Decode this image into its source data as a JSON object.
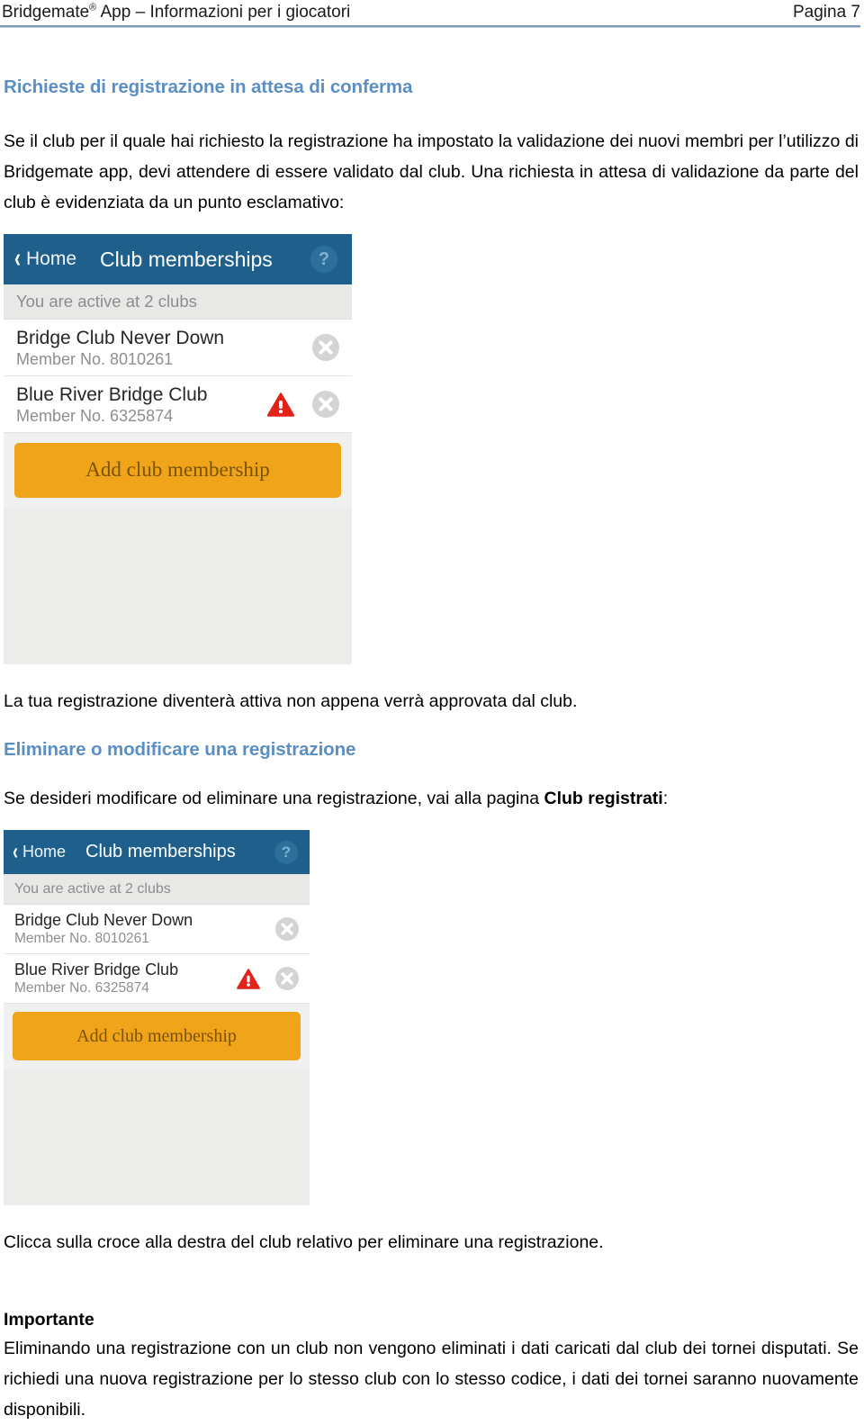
{
  "header": {
    "left_text": "Bridgemate",
    "left_sup": "®",
    "left_rest": " App – Informazioni per i giocatori",
    "page_label": "Pagina 7"
  },
  "sections": {
    "heading_1": "Richieste di registrazione in attesa di conferma",
    "paragraph_1": "Se il club per il quale hai richiesto la registrazione ha impostato la validazione dei nuovi membri per l’utilizzo di Bridgemate app, devi attendere di essere validato dal club. Una richiesta in attesa di validazione da parte del club è evidenziata da un punto esclamativo:",
    "paragraph_2": "La tua registrazione diventerà attiva non appena verrà approvata dal club.",
    "heading_2": "Eliminare o modificare una registrazione",
    "paragraph_3_before": "Se desideri modificare od eliminare una registrazione, vai alla pagina ",
    "paragraph_3_bold": "Club registrati",
    "paragraph_3_after": ":",
    "paragraph_4": "Clicca sulla croce alla destra del club relativo per eliminare una registrazione.",
    "heading_3": "Importante",
    "paragraph_5": "Eliminando una registrazione con un club non vengono eliminati i dati caricati dal club dei tornei disputati. Se richiedi una nuova registrazione per lo stesso club con lo stesso codice, i dati dei tornei saranno nuovamente disponibili."
  },
  "app_screenshot": {
    "back_label": "Home",
    "title": "Club memberships",
    "help_glyph": "?",
    "back_glyph": "‹",
    "subbar_text": "You are active at 2 clubs",
    "clubs": [
      {
        "name": "Bridge Club Never Down",
        "member": "Member No. 8010261",
        "pending": false
      },
      {
        "name": "Blue River Bridge Club",
        "member": "Member No. 6325874",
        "pending": true
      }
    ],
    "add_button_label": "Add club membership"
  },
  "colors": {
    "heading_blue": "#5b8fc4",
    "app_bar_blue": "#1f5f8b",
    "add_button_orange": "#f0a41a",
    "warning_red": "#e2231a",
    "header_rule": "#7e99b8"
  }
}
